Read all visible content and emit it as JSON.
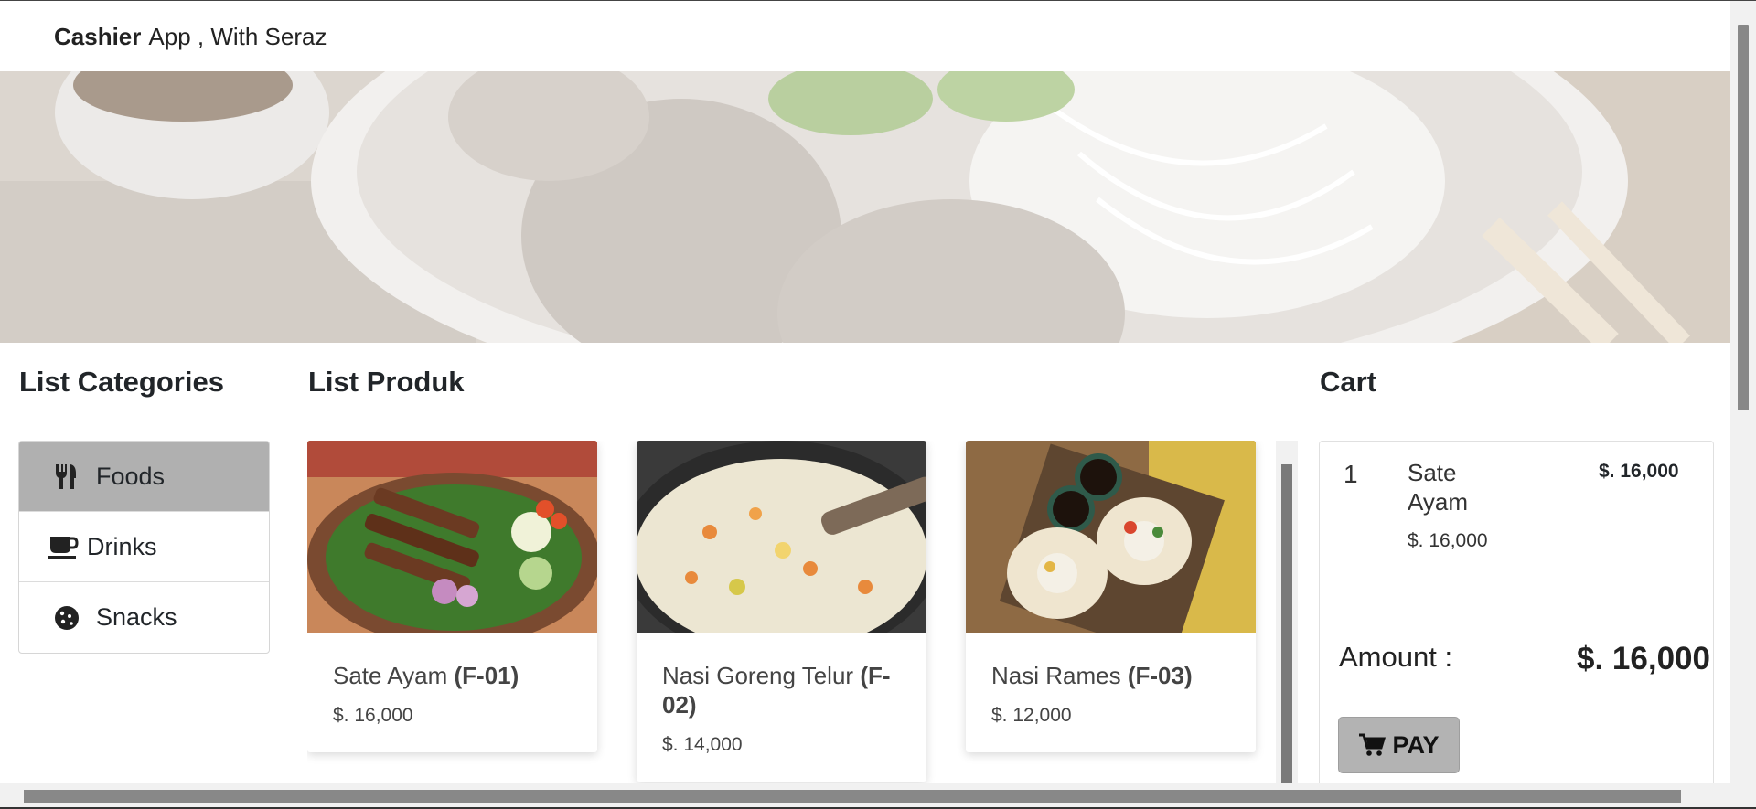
{
  "navbar": {
    "brand_bold": "Cashier",
    "brand_rest": "App , With Seraz"
  },
  "categories": {
    "title": "List Categories",
    "items": [
      {
        "label": "Foods",
        "icon": "utensils-icon",
        "active": true
      },
      {
        "label": "Drinks",
        "icon": "mug-icon",
        "active": false
      },
      {
        "label": "Snacks",
        "icon": "cookie-icon",
        "active": false
      }
    ]
  },
  "products": {
    "title": "List Produk",
    "items": [
      {
        "name": "Sate Ayam",
        "code": "(F-01)",
        "price": "$. 16,000"
      },
      {
        "name": "Nasi Goreng Telur",
        "code": "(F-02)",
        "price": "$. 14,000"
      },
      {
        "name": "Nasi Rames",
        "code": "(F-03)",
        "price": "$. 12,000"
      }
    ]
  },
  "cart": {
    "title": "Cart",
    "items": [
      {
        "qty": "1",
        "name": "Sate Ayam",
        "price": "$. 16,000",
        "total": "$. 16,000"
      }
    ],
    "amount_label": "Amount :",
    "amount_value": "$. 16,000",
    "pay_label": "PAY"
  },
  "colors": {
    "active_category": "#b0b0b0",
    "pay_button": "#b3b3b3",
    "text": "#212529"
  }
}
